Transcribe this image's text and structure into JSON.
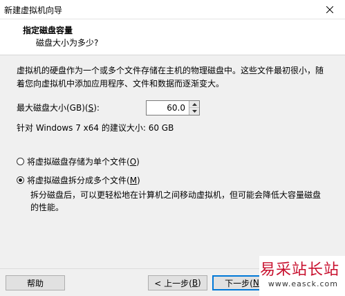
{
  "window": {
    "title": "新建虚拟机向导",
    "close_icon": "close-icon"
  },
  "header": {
    "title": "指定磁盘容量",
    "subtitle": "磁盘大小为多少?"
  },
  "description": "虚拟机的硬盘作为一个或多个文件存储在主机的物理磁盘中。这些文件最初很小，随着您向虚拟机中添加应用程序、文件和数据而逐渐变大。",
  "disk_size": {
    "label_prefix": "最大磁盘大小(GB)(",
    "label_mnemonic": "S",
    "label_suffix": "):",
    "value": "60.0",
    "recommended_text": "针对 Windows 7 x64 的建议大小: 60 GB"
  },
  "storage_options": [
    {
      "label_prefix": "将虚拟磁盘存储为单个文件(",
      "label_mnemonic": "O",
      "label_suffix": ")",
      "checked": false
    },
    {
      "label_prefix": "将虚拟磁盘拆分成多个文件(",
      "label_mnemonic": "M",
      "label_suffix": ")",
      "checked": true
    }
  ],
  "split_note": "拆分磁盘后，可以更轻松地在计算机之间移动虚拟机，但可能会降低大容量磁盘的性能。",
  "buttons": {
    "help": "帮助",
    "back_prefix": "< 上一步(",
    "back_mnemonic": "B",
    "back_suffix": ")",
    "next_prefix": "下一步(",
    "next_mnemonic": "N"
  },
  "watermark": {
    "title": "易采站长站",
    "url": "www.easck.com"
  }
}
